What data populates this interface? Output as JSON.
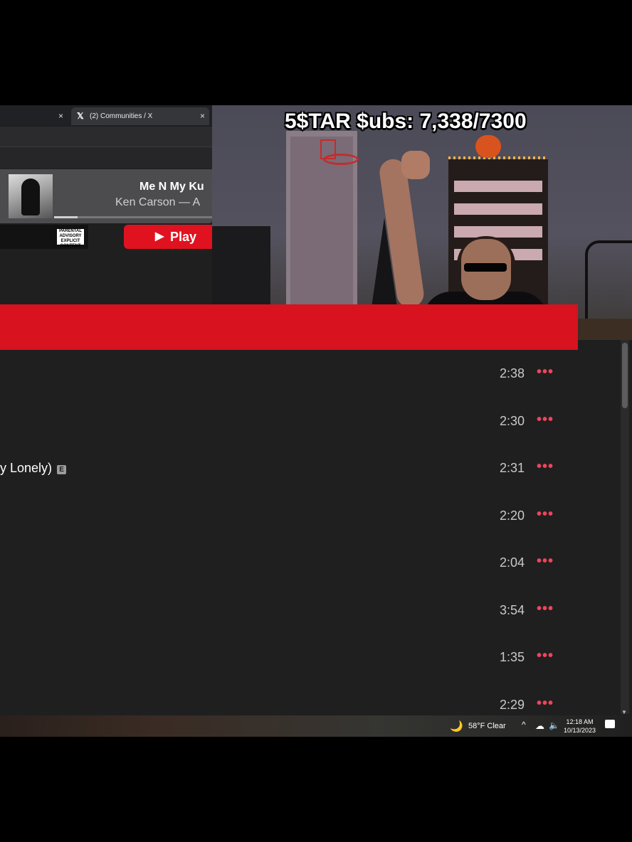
{
  "browser": {
    "tabs": [
      {
        "label": "",
        "close": "×"
      },
      {
        "label": "(2) Communities / X",
        "close": "×"
      }
    ]
  },
  "now_playing": {
    "title": "Me N My Ku",
    "artist": "Ken Carson — A",
    "progress": 0.15
  },
  "album": {
    "advisory": "PARENTAL ADVISORY EXPLICIT CONTENT",
    "play_label": "Play"
  },
  "stream": {
    "sub_counter": "5$TAR $ubs: 7,338/7300"
  },
  "tracks": [
    {
      "title": "",
      "explicit": false,
      "duration": "2:38"
    },
    {
      "title": "",
      "explicit": false,
      "duration": "2:30"
    },
    {
      "title": "y Lonely)",
      "explicit": true,
      "explicit_label": "E",
      "duration": "2:31"
    },
    {
      "title": "",
      "explicit": false,
      "duration": "2:20"
    },
    {
      "title": "",
      "explicit": false,
      "duration": "2:04"
    },
    {
      "title": "",
      "explicit": false,
      "duration": "3:54"
    },
    {
      "title": "",
      "explicit": false,
      "duration": "1:35"
    },
    {
      "title": "",
      "explicit": false,
      "duration": "2:29"
    }
  ],
  "more_glyph": "•••",
  "taskbar": {
    "weather_icon": "moon-icon",
    "weather": "58°F  Clear",
    "time": "12:18 AM",
    "date": "10/13/2023"
  },
  "colors": {
    "accent": "#e01220",
    "more_icon": "#f0455b",
    "background": "#1f1f20"
  }
}
